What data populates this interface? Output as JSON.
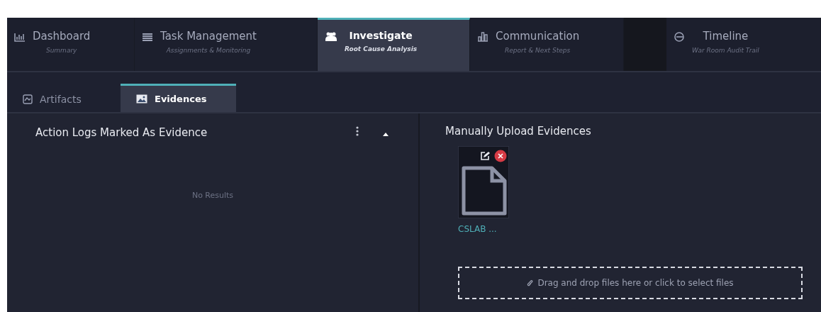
{
  "main_tabs": [
    {
      "kind": "chart",
      "label": "Dashboard",
      "subtitle": "Summary",
      "selected": false
    },
    {
      "kind": "list",
      "label": "Task Management",
      "subtitle": "Assignments & Monitoring",
      "selected": false
    },
    {
      "kind": "people",
      "label": "Investigate",
      "subtitle": "Root Cause Analysis",
      "selected": true
    },
    {
      "kind": "bars",
      "label": "Communication",
      "subtitle": "Report & Next Steps",
      "selected": false
    },
    {
      "kind": "timeline",
      "label": "Timeline",
      "subtitle": "War Room Audit Trail",
      "selected": false
    }
  ],
  "sub_tabs": [
    {
      "kind": "artifact",
      "label": "Artifacts",
      "selected": false
    },
    {
      "kind": "image",
      "label": "Evidences",
      "selected": true
    }
  ],
  "action_logs": {
    "title": "Action Logs Marked As Evidence",
    "expanded": true,
    "empty_message": "No Results"
  },
  "uploads": {
    "title": "Manually Upload Evidences",
    "files": [
      {
        "name": "CSLAB ..."
      }
    ],
    "dropzone": "Drag and drop files here or click to select files"
  }
}
